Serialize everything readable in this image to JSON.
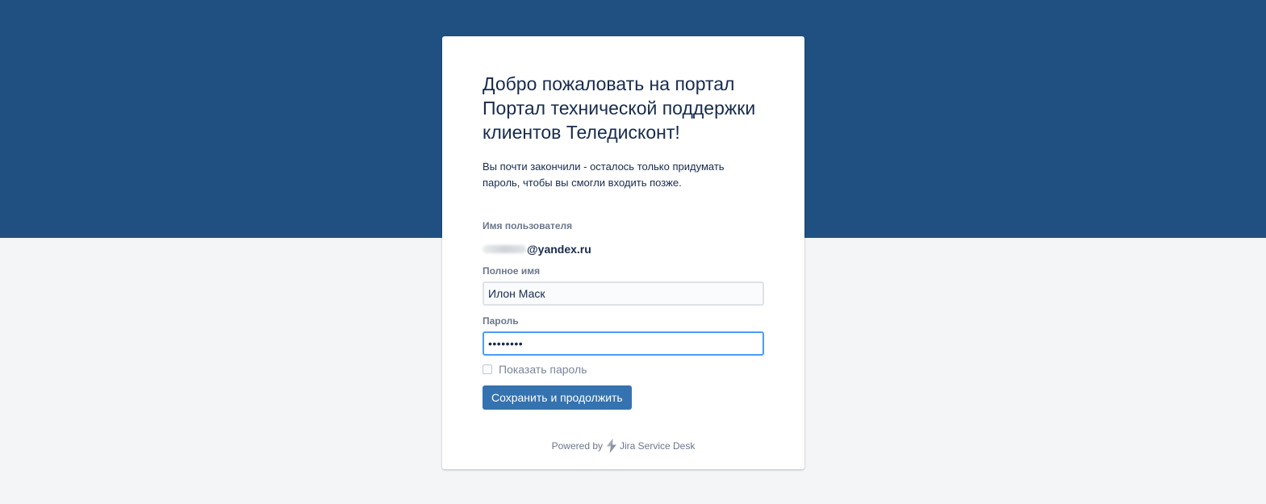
{
  "welcome": {
    "title": "Добро пожаловать на портал Портал технической поддержки клиентов Теледисконт!",
    "text": "Вы почти закончили - осталось только придумать пароль, чтобы вы смогли входить позже."
  },
  "form": {
    "username_label": "Имя пользователя",
    "username_value": "@yandex.ru",
    "fullname_label": "Полное имя",
    "fullname_value": "Илон Маск",
    "password_label": "Пароль",
    "password_value": "12345678",
    "show_password_label": "Показать пароль",
    "show_password_checked": false,
    "submit_label": "Сохранить и продолжить"
  },
  "footer": {
    "powered_by": "Powered by",
    "product": "Jira Service Desk",
    "product_icon": "jira-bolt-icon"
  },
  "colors": {
    "header_band": "#205081",
    "primary_button": "#3572b0",
    "focus_border": "#4c9aff",
    "page_background": "#f4f5f7"
  }
}
